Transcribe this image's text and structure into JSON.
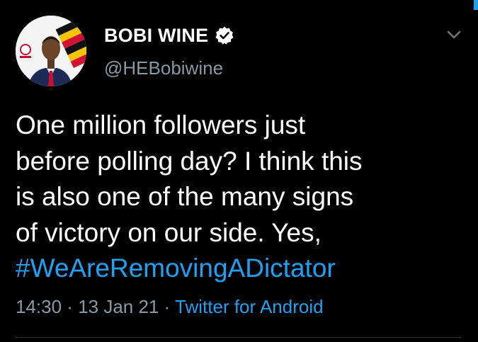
{
  "author": {
    "name": "BOBI WINE",
    "handle": "@HEBobiwine",
    "verified_icon": "verified-badge-icon",
    "avatar_icon": "profile-photo"
  },
  "menu": {
    "icon": "chevron-down-icon"
  },
  "tweet": {
    "lines": [
      "One million followers just",
      "before polling day? I think this",
      "is also one of the many signs",
      "of victory on our side. Yes,"
    ],
    "hashtag": "#WeAreRemovingADictator"
  },
  "meta": {
    "time": "14:30",
    "separator": " · ",
    "date": "13 Jan 21",
    "source": "Twitter for Android"
  },
  "colors": {
    "background": "#000000",
    "text": "#ffffff",
    "secondary": "#8899a6",
    "accent": "#1da1f2"
  }
}
